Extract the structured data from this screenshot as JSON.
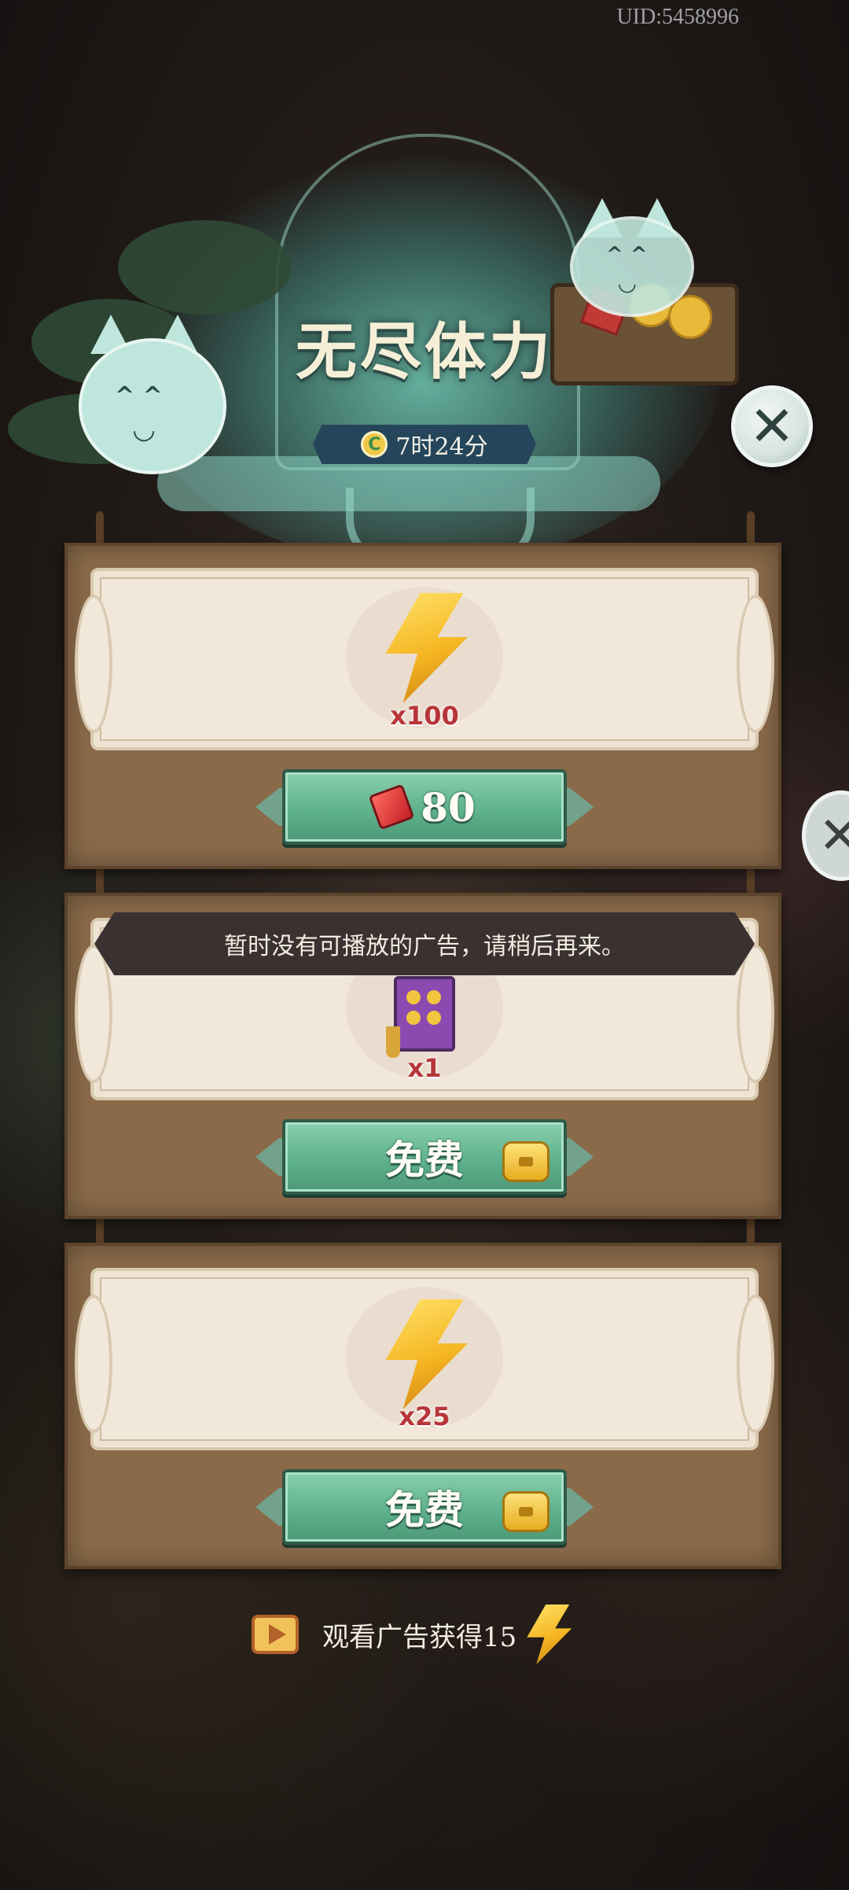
{
  "uid": "UID:5458996",
  "header": {
    "title": "无尽体力",
    "timer": "7时24分"
  },
  "cards": [
    {
      "quantity": "x100",
      "button_label": "80"
    },
    {
      "quantity": "x1",
      "button_label": "免费"
    },
    {
      "quantity": "x25",
      "button_label": "免费"
    }
  ],
  "toast": "暂时没有可播放的广告，请稍后再来。",
  "footer": {
    "text": "观看广告获得15"
  },
  "colors": {
    "button_green": "#5fb28d",
    "board_brown": "#8a6a49",
    "panel_cream": "#f1e8da",
    "qty_red": "#b7353a"
  }
}
